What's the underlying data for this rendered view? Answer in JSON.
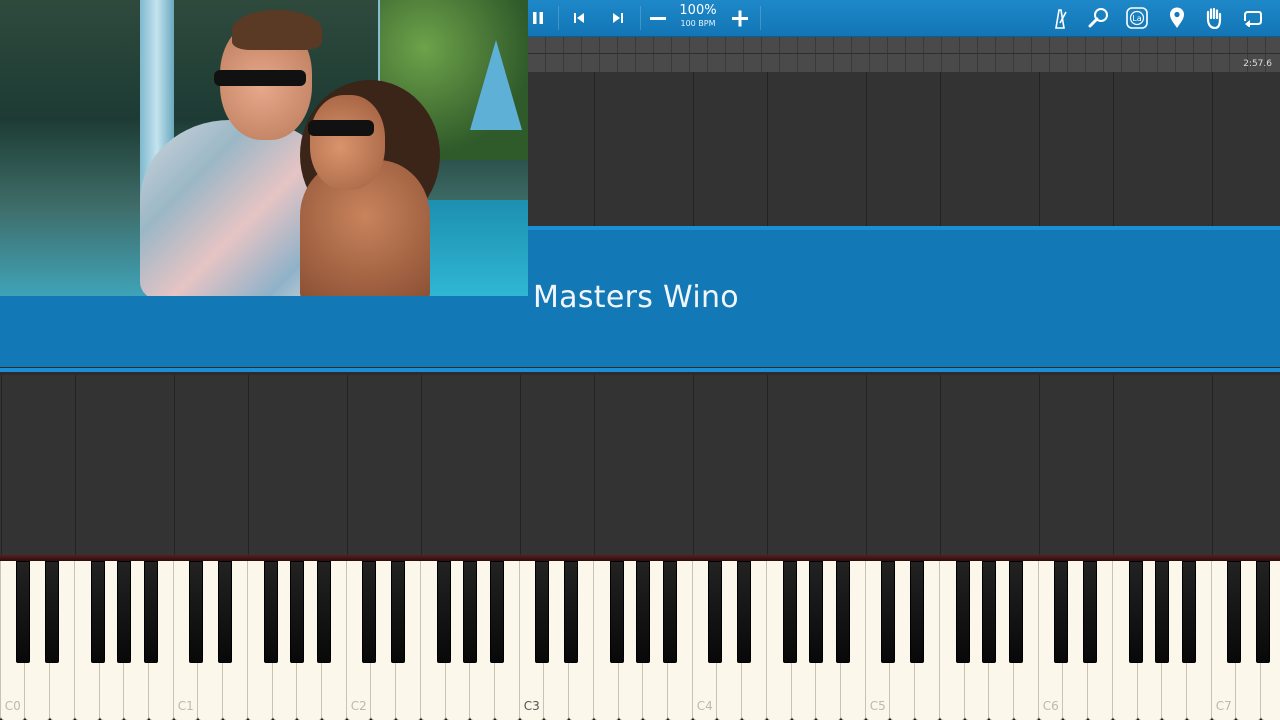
{
  "toolbar": {
    "tempo_percent": "100%",
    "tempo_bpm": "100 BPM",
    "buttons": {
      "pause": "pause-icon",
      "previous": "skip-back-icon",
      "next": "skip-forward-icon",
      "slower": "minus-icon",
      "faster": "plus-icon",
      "metronome": "metronome-icon",
      "zoom": "magnifier-icon",
      "note_labels": "La",
      "marker": "map-pin-icon",
      "hand": "hand-icon",
      "loop": "loop-icon"
    }
  },
  "timeline": {
    "time": "2:57.6"
  },
  "song": {
    "title": "Masters Wino"
  },
  "keyboard": {
    "octave_labels": [
      "C0",
      "C1",
      "C2",
      "C3",
      "C4",
      "C5",
      "C6",
      "C7"
    ]
  },
  "colors": {
    "accent": "#1378b6",
    "toolbar": "#1e88c8",
    "lane_bg": "#333333",
    "white_key": "#fbf7ea"
  }
}
